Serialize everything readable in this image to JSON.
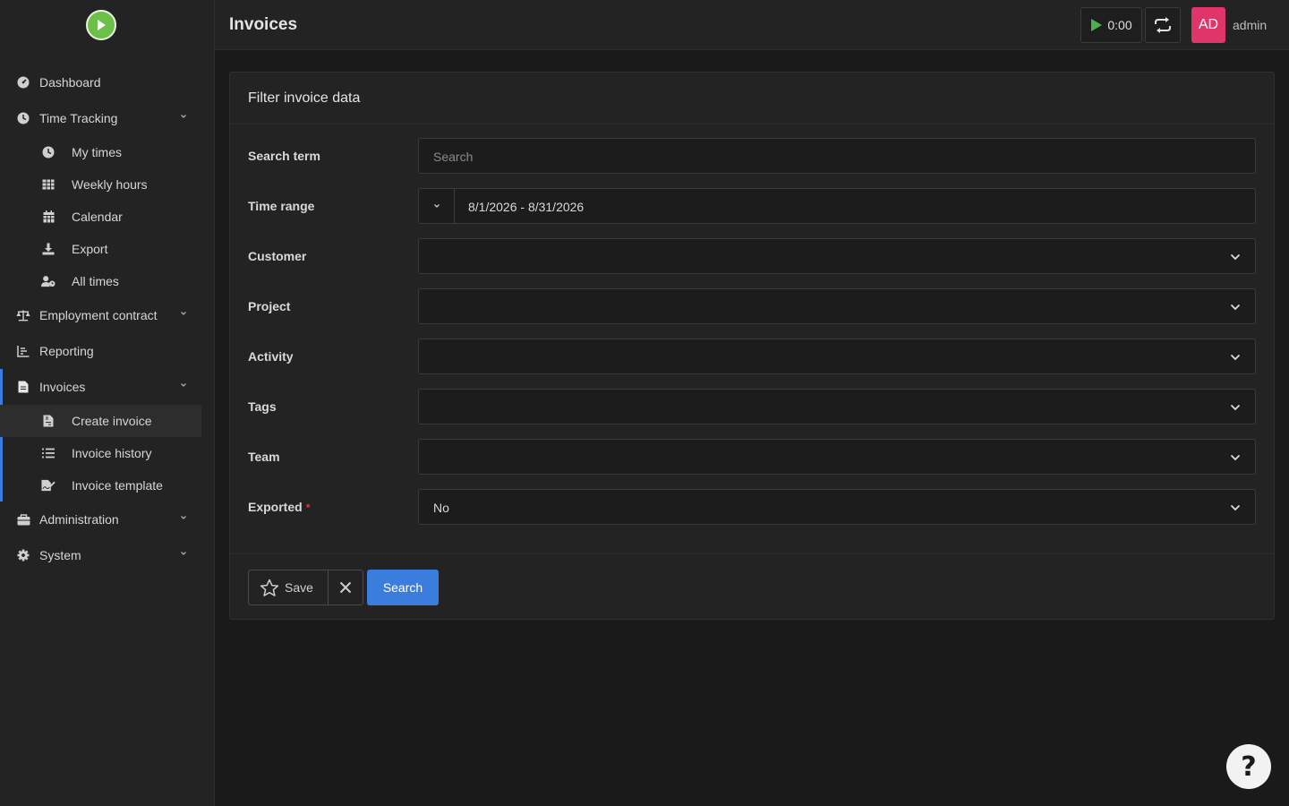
{
  "header": {
    "title": "Invoices",
    "timer": "0:00",
    "avatar_initials": "AD",
    "username": "admin"
  },
  "sidebar": {
    "items": [
      {
        "label": "Dashboard",
        "icon": "dashboard-icon"
      },
      {
        "label": "Time Tracking",
        "icon": "clock-icon",
        "expanded": true,
        "children": [
          {
            "label": "My times",
            "icon": "clock-icon"
          },
          {
            "label": "Weekly hours",
            "icon": "table-icon"
          },
          {
            "label": "Calendar",
            "icon": "calendar-icon"
          },
          {
            "label": "Export",
            "icon": "download-icon"
          },
          {
            "label": "All times",
            "icon": "user-clock-icon"
          }
        ]
      },
      {
        "label": "Employment contract",
        "icon": "balance-scale-icon"
      },
      {
        "label": "Reporting",
        "icon": "chart-icon"
      },
      {
        "label": "Invoices",
        "icon": "invoice-icon",
        "active": true,
        "children": [
          {
            "label": "Create invoice",
            "icon": "file-invoice-icon",
            "active": true
          },
          {
            "label": "Invoice history",
            "icon": "list-icon"
          },
          {
            "label": "Invoice template",
            "icon": "file-signature-icon"
          }
        ]
      },
      {
        "label": "Administration",
        "icon": "toolbox-icon"
      },
      {
        "label": "System",
        "icon": "gear-icon"
      }
    ]
  },
  "filter": {
    "title": "Filter invoice data",
    "search_label": "Search term",
    "search_placeholder": "Search",
    "range_label": "Time range",
    "range_value": "8/1/2026 - 8/31/2026",
    "customer_label": "Customer",
    "project_label": "Project",
    "activity_label": "Activity",
    "tags_label": "Tags",
    "team_label": "Team",
    "exported_label": "Exported",
    "exported_required_mark": "*",
    "exported_value": "No",
    "save_label": "Save",
    "search_button": "Search"
  },
  "help": {
    "label": "?"
  },
  "colors": {
    "accent": "#3b7ddd",
    "avatar": "#e0356a",
    "logo": "#6cc04a",
    "timer_play": "#4caf50",
    "required": "#d63939"
  }
}
